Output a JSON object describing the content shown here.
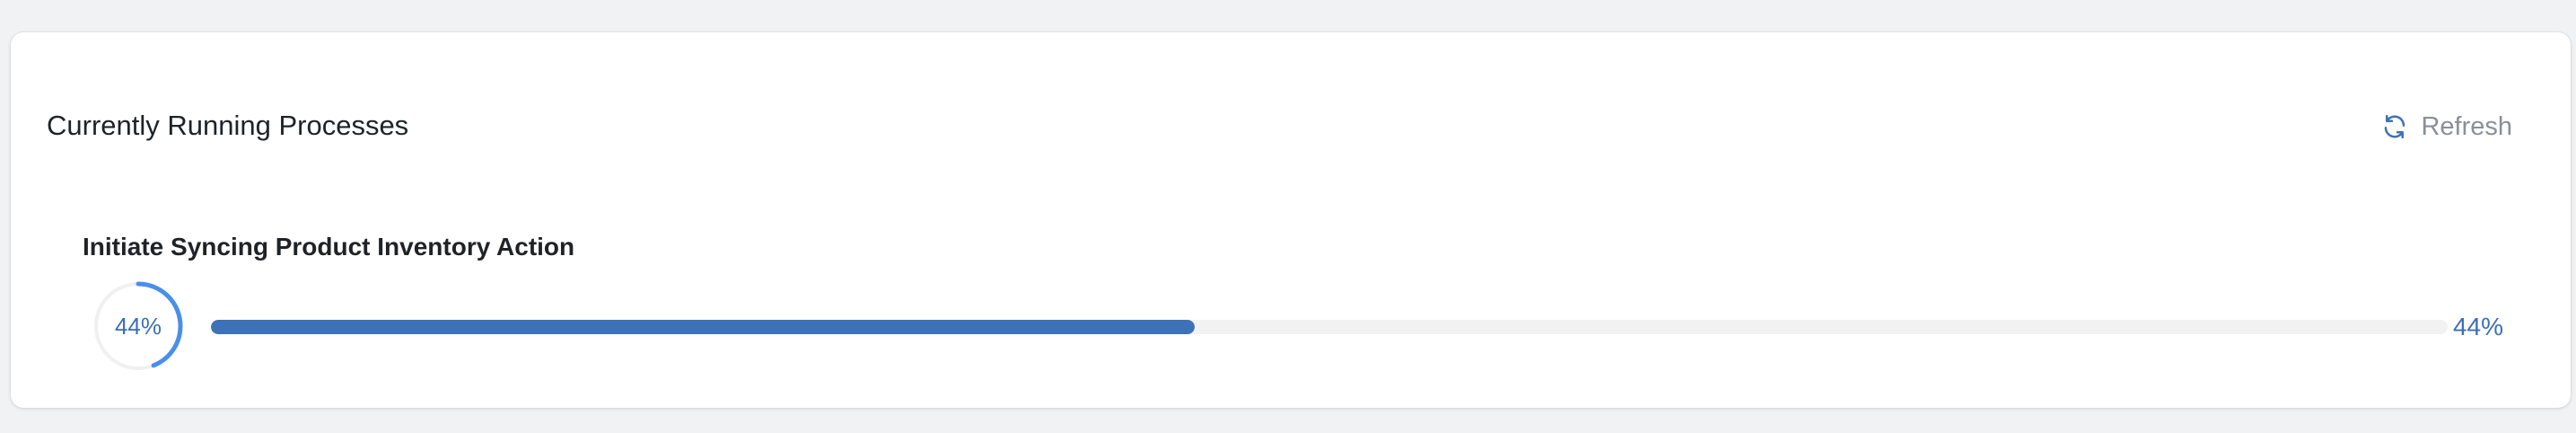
{
  "card": {
    "title": "Currently Running Processes",
    "refresh_label": "Refresh",
    "refresh_icon": "refresh-icon"
  },
  "process": {
    "name": "Initiate Syncing Product Inventory Action",
    "progress_percent": 44,
    "circle_label": "44%",
    "bar_label": "44%"
  },
  "colors": {
    "accent": "#3e72b8",
    "ring_accent": "#4a8fe8",
    "track": "#f2f2f2",
    "muted_text": "#8a8f98",
    "background": "#f1f2f4"
  }
}
